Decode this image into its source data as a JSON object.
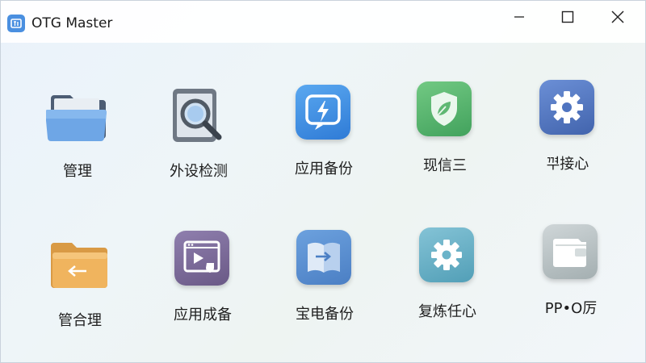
{
  "window": {
    "title": "OTG Master",
    "app_icon": "otg-master-app-icon",
    "controls": {
      "minimize_icon": "minimize-icon",
      "maximize_icon": "maximize-icon",
      "close_icon": "close-icon"
    }
  },
  "tiles_row1": [
    {
      "label": "管理",
      "icon": "folder-icon"
    },
    {
      "label": "外设检测",
      "icon": "tablet-search-icon"
    },
    {
      "label": "应用备份",
      "icon": "lightning-icon"
    },
    {
      "label": "现信三",
      "icon": "shield-leaf-icon"
    },
    {
      "label": "ᄁᅾ接心",
      "icon": "gear-icon"
    }
  ],
  "tiles_row2": [
    {
      "label": "管合理",
      "icon": "folder-arrow-icon"
    },
    {
      "label": "应用成备",
      "icon": "media-window-icon"
    },
    {
      "label": "宝电备份",
      "icon": "book-transfer-icon"
    },
    {
      "label": "复炼任心",
      "icon": "gear-icon"
    },
    {
      "label": "PP•O厉",
      "icon": "wallet-icon"
    }
  ],
  "colors": {
    "title_accent": "#4a8fe0",
    "folder_blue": "#6ea6e6",
    "search_gray": "#8d96a0",
    "lightning_blue": "#3f8fe2",
    "shield_green": "#5fb873",
    "gear_blue": "#4f74c0",
    "folder_orange": "#f0b45e",
    "media_purple": "#7d6c99",
    "book_blue": "#5d8fd0",
    "gear_teal": "#6ab3c9",
    "wallet_gray": "#b7c0c2"
  }
}
